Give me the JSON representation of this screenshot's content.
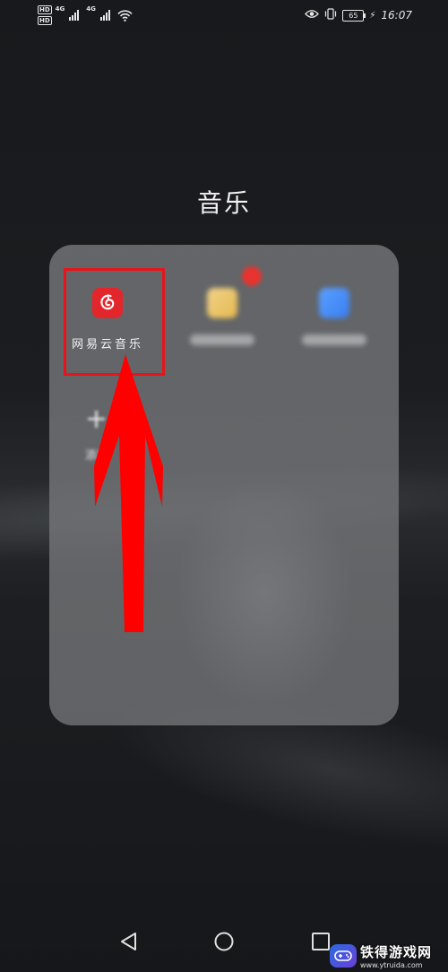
{
  "status_bar": {
    "hd_1": "HD",
    "hd_2": "HD",
    "network_1": "4G",
    "network_2": "4G",
    "battery_level": "65",
    "time": "16:07"
  },
  "folder": {
    "title": "音乐",
    "apps": [
      {
        "label": "网易云音乐",
        "icon": "netease-cloud-music-icon",
        "color": "#e3262b"
      },
      {
        "icon": "blurred-app-icon",
        "color": "#e6b94f"
      },
      {
        "icon": "blurred-app-icon",
        "color": "#3a7ef0"
      }
    ],
    "badge_color": "#e8332e",
    "add_label": "添加",
    "add_symbol": "+"
  },
  "annotation": {
    "highlight_color": "#e8141b",
    "arrow_color": "#ff0000"
  },
  "watermark": {
    "name": "铁得游戏网",
    "url": "www.ytruida.com"
  }
}
